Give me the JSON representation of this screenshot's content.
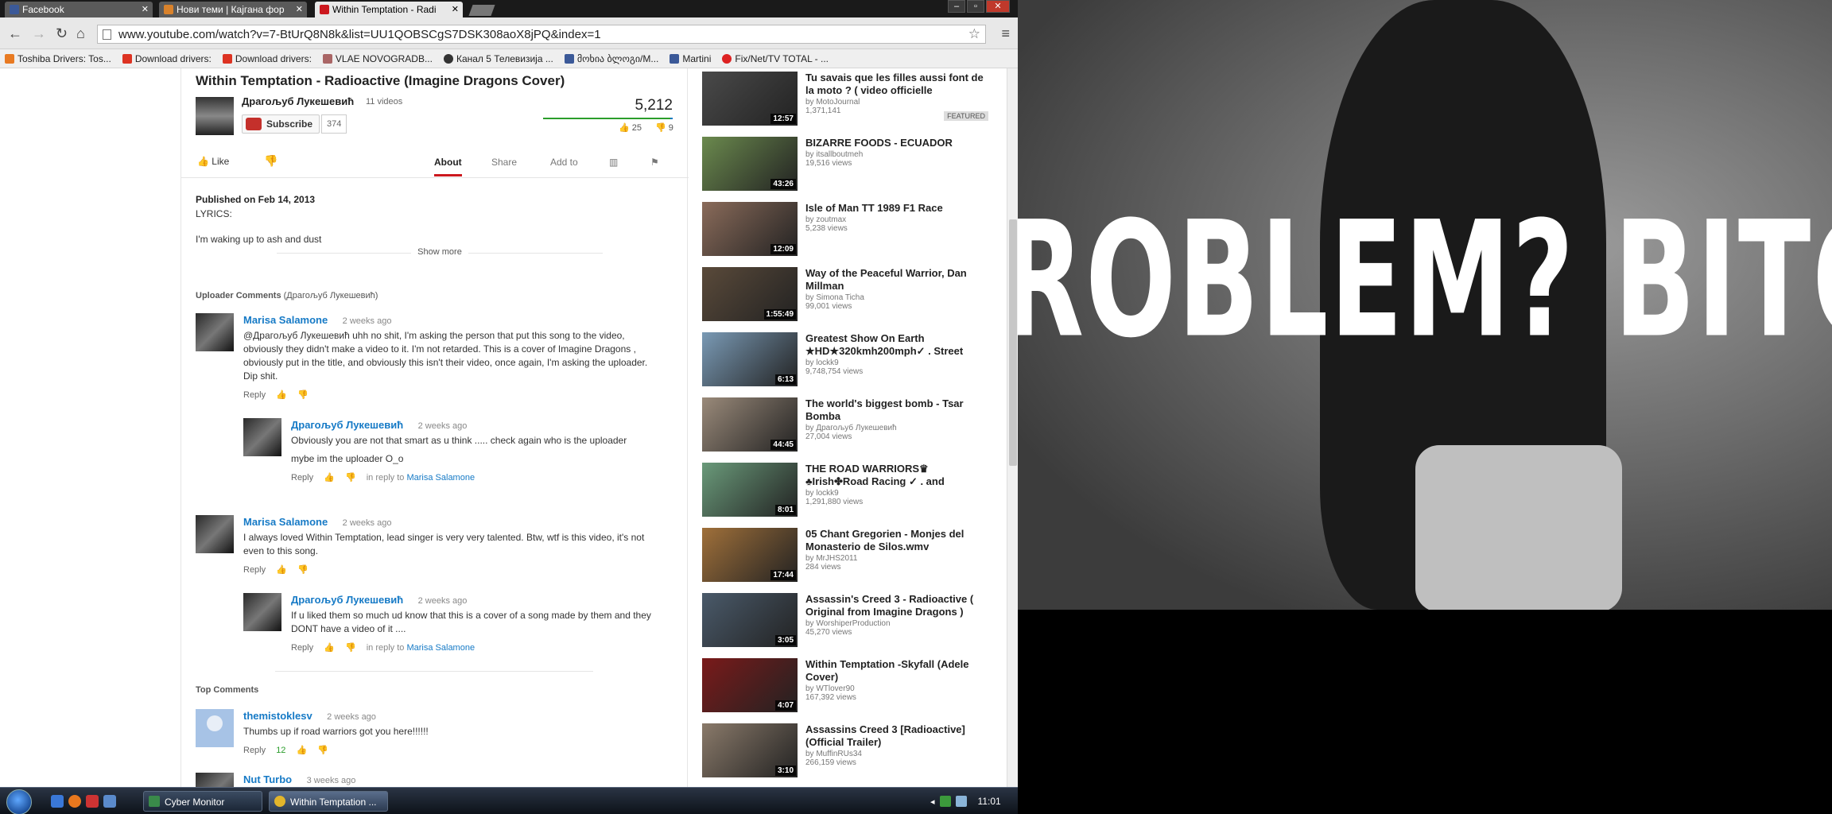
{
  "browser": {
    "tabs": [
      {
        "label": "Facebook"
      },
      {
        "label": "Нови теми | Кајгана фор"
      },
      {
        "label": "Within Temptation - Radi"
      }
    ],
    "url": "www.youtube.com/watch?v=7-BtUrQ8N8k&list=UU1QOBSCgS7DSK308aoX8jPQ&index=1",
    "bookmarks": [
      "Toshiba Drivers: Tos...",
      "Download drivers:",
      "Download drivers:",
      "VLAE NOVOGRADB...",
      "Канал 5 Телевизија ...",
      "მოხია ბლოგი/M...",
      "Martini",
      "Fix/Net/TV TOTAL - ..."
    ]
  },
  "video": {
    "title": "Within Temptation - Radioactive (Imagine Dragons Cover)",
    "owner": "Драгољуб Лукешевић",
    "owner_videos": "11 videos",
    "subscribe_label": "Subscribe",
    "subscriber_count": "374",
    "views": "5,212",
    "likes": "25",
    "dislikes": "9",
    "like_label": "Like",
    "tabs": [
      "About",
      "Share",
      "Add to"
    ],
    "published": "Published on Feb 14, 2013",
    "desc_line1": "LYRICS:",
    "desc_line2": "I'm waking up to ash and dust",
    "show_more": "Show more"
  },
  "uploader_comments": {
    "header": "Uploader Comments",
    "header_sub": "(Драгољуб Лукешевић)",
    "items": [
      {
        "author": "Marisa Salamone",
        "time": "2 weeks ago",
        "text": "@Драгољуб Лукешевић uhh no shit, I'm asking the person that put this song to the video, obviously they didn't make a video to it. I'm not retarded. This is a cover of Imagine Dragons , obviously put in the title, and obviously this isn't their video, once again, I'm asking the uploader. Dip shit.",
        "reply": "Reply"
      },
      {
        "author": "Драгољуб Лукешевић",
        "time": "2 weeks ago",
        "text": "Obviously you are not that smart as u think ..... check again who is the uploader",
        "text2": "mybe im the uploader O_o",
        "reply": "Reply",
        "in_reply": "in reply to",
        "in_reply_to": "Marisa Salamone"
      },
      {
        "author": "Marisa Salamone",
        "time": "2 weeks ago",
        "text": "I always loved Within Temptation, lead singer is very very talented. Btw, wtf is this video, it's not even to this song.",
        "reply": "Reply"
      },
      {
        "author": "Драгољуб Лукешевић",
        "time": "2 weeks ago",
        "text": "If u liked them so much ud know that this is a cover of a song made by them and they DONT have a video of it ....",
        "reply": "Reply",
        "in_reply": "in reply to",
        "in_reply_to": "Marisa Salamone"
      }
    ]
  },
  "top_comments": {
    "header": "Top Comments",
    "items": [
      {
        "author": "themistoklesv",
        "time": "2 weeks ago",
        "text": "Thumbs up if road warriors got you here!!!!!!",
        "reply": "Reply",
        "likes": "12"
      },
      {
        "author": "Nut Turbo",
        "time": "3 weeks ago"
      }
    ]
  },
  "related": [
    {
      "title": "Tu savais que les filles aussi font de la moto ? ( video officielle",
      "by": "MotoJournal",
      "views": "1,371,141",
      "duration": "12:57",
      "featured": "FEATURED",
      "color": "#4a4a4a"
    },
    {
      "title": "BIZARRE FOODS - ECUADOR",
      "by": "itsallboutmeh",
      "views": "19,516 views",
      "duration": "43:26",
      "color": "#6b8a4e"
    },
    {
      "title": "Isle of Man TT 1989 F1 Race",
      "by": "zoutmax",
      "views": "5,238 views",
      "duration": "12:09",
      "color": "#8a6b5a"
    },
    {
      "title": "Way of the Peaceful Warrior, Dan Millman",
      "by": "Simona Ticha",
      "views": "99,001 views",
      "duration": "1:55:49",
      "color": "#5a4a3a"
    },
    {
      "title": "Greatest Show On Earth ★HD★320kmh200mph✓ . Street",
      "by": "lockk9",
      "views": "9,748,754 views",
      "duration": "6:13",
      "color": "#7a9ab5"
    },
    {
      "title": "The world's biggest bomb - Tsar Bomba",
      "by": "Драгољуб Лукешевић",
      "views": "27,004 views",
      "duration": "44:45",
      "color": "#9a8a7a"
    },
    {
      "title": "THE ROAD WARRIORS♛ ♣Irish✤Road Racing ✓ . and",
      "by": "lockk9",
      "views": "1,291,880 views",
      "duration": "8:01",
      "color": "#6a9a7a"
    },
    {
      "title": "05 Chant Gregorien - Monjes del Monasterio de Silos.wmv",
      "by": "MrJHS2011",
      "views": "284 views",
      "duration": "17:44",
      "color": "#a0703a"
    },
    {
      "title": "Assassin's Creed 3 - Radioactive ( Original from Imagine Dragons )",
      "by": "WorshiperProduction",
      "views": "45,270 views",
      "duration": "3:05",
      "color": "#4a5a6a"
    },
    {
      "title": "Within Temptation -Skyfall (Adele Cover)",
      "by": "WTlover90",
      "views": "167,392 views",
      "duration": "4:07",
      "color": "#7a1a1a"
    },
    {
      "title": "Assassins Creed 3 [Radioactive] (Official Trailer)",
      "by": "MuffinRUs34",
      "views": "266,159 views",
      "duration": "3:10",
      "color": "#8a7a6a"
    }
  ],
  "right_image": {
    "text": "ROBLEM? BITCH"
  },
  "taskbar": {
    "buttons": [
      "Cyber Monitor",
      "Within Temptation ..."
    ],
    "clock": "11:01"
  }
}
